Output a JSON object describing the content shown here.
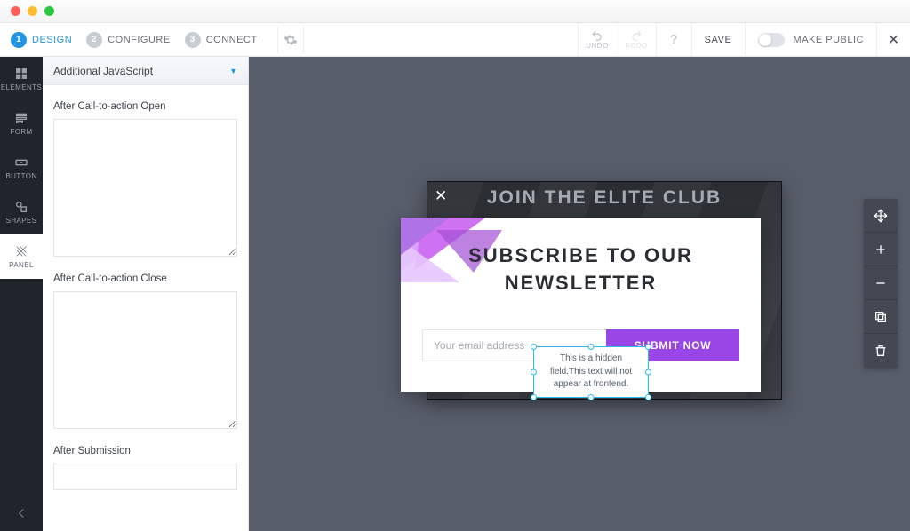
{
  "steps": [
    {
      "num": "1",
      "label": "DESIGN",
      "active": true
    },
    {
      "num": "2",
      "label": "CONFIGURE",
      "active": false
    },
    {
      "num": "3",
      "label": "CONNECT",
      "active": false
    }
  ],
  "topbar": {
    "undo": "UNDO",
    "redo": "REDO",
    "save": "SAVE",
    "make_public": "MAKE PUBLIC"
  },
  "rail": {
    "elements": "ELEMENTS",
    "form": "FORM",
    "button": "BUTTON",
    "shapes": "SHAPES",
    "panel": "PANEL"
  },
  "panel": {
    "section_title": "Additional JavaScript",
    "field_open": "After Call-to-action Open",
    "field_close": "After Call-to-action Close",
    "field_submit": "After Submission",
    "val_open": "",
    "val_close": "",
    "val_submit": ""
  },
  "preview": {
    "band_title": "JOIN THE ELITE CLUB",
    "card_heading": "SUBSCRIBE TO OUR NEWSLETTER",
    "email_placeholder": "Your email address",
    "submit_label": "SUBMIT NOW",
    "hidden_text": "This is a hidden field.This text will not appear at frontend."
  }
}
